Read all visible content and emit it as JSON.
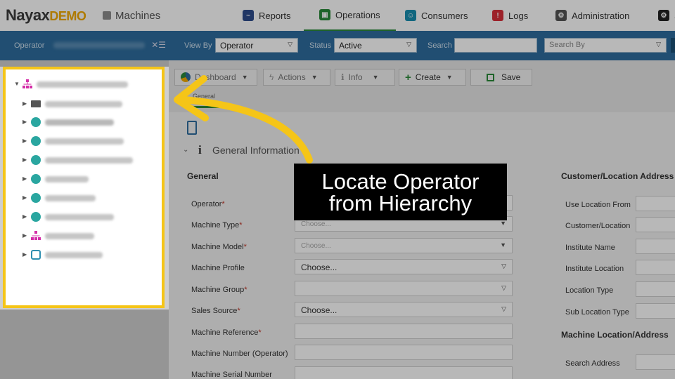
{
  "app": {
    "brand": "Nayax",
    "demo": "DEMO",
    "module": "Machines"
  },
  "nav": {
    "tabs": [
      {
        "label": "Reports",
        "color": "#2e4d8c"
      },
      {
        "label": "Operations",
        "color": "#2a8a3a",
        "active": true
      },
      {
        "label": "Consumers",
        "color": "#1a8fb0"
      },
      {
        "label": "Logs",
        "color": "#d92f3a"
      },
      {
        "label": "Administration",
        "color": "#555555"
      },
      {
        "label": "S",
        "color": "#222222"
      }
    ]
  },
  "filterbar": {
    "operator_label": "Operator",
    "clear_icon": "clear-list-icon",
    "viewby_label": "View By",
    "viewby_value": "Operator",
    "status_label": "Status",
    "status_value": "Active",
    "search_label": "Search",
    "search_value": "",
    "searchby_value": "Search By"
  },
  "toolbar": {
    "dashboard": "Dashboard",
    "actions": "Actions",
    "info": "Info",
    "create": "Create",
    "save": "Save",
    "tab": "General"
  },
  "section": {
    "info_glyph": "i",
    "title": "General Information"
  },
  "general": {
    "title": "General",
    "fields": [
      {
        "label": "Operator",
        "required": true,
        "value": "",
        "type": "text"
      },
      {
        "label": "Machine Type",
        "required": true,
        "value": "Choose...",
        "type": "placeholder-select"
      },
      {
        "label": "Machine Model",
        "required": true,
        "value": "Choose...",
        "type": "placeholder-select"
      },
      {
        "label": "Machine Profile",
        "required": false,
        "value": "Choose...",
        "type": "select"
      },
      {
        "label": "Machine Group",
        "required": true,
        "value": "",
        "type": "select"
      },
      {
        "label": "Sales Source",
        "required": true,
        "value": "Choose...",
        "type": "select"
      },
      {
        "label": "Machine Reference",
        "required": true,
        "value": "",
        "type": "text"
      },
      {
        "label": "Machine Number (Operator)",
        "required": false,
        "value": "",
        "type": "text"
      },
      {
        "label": "Machine Serial Number",
        "required": false,
        "value": "",
        "type": "text"
      }
    ]
  },
  "customer": {
    "title": "Customer/Location Address",
    "fields": [
      "Use Location From",
      "Customer/Location",
      "Institute Name",
      "Institute Location",
      "Location Type",
      "Sub Location Type"
    ],
    "machine_location_title": "Machine Location/Address",
    "search_address": "Search Address"
  },
  "callout": {
    "line1": "Locate Operator",
    "line2": "from Hierarchy",
    "color": "#f5c518"
  }
}
